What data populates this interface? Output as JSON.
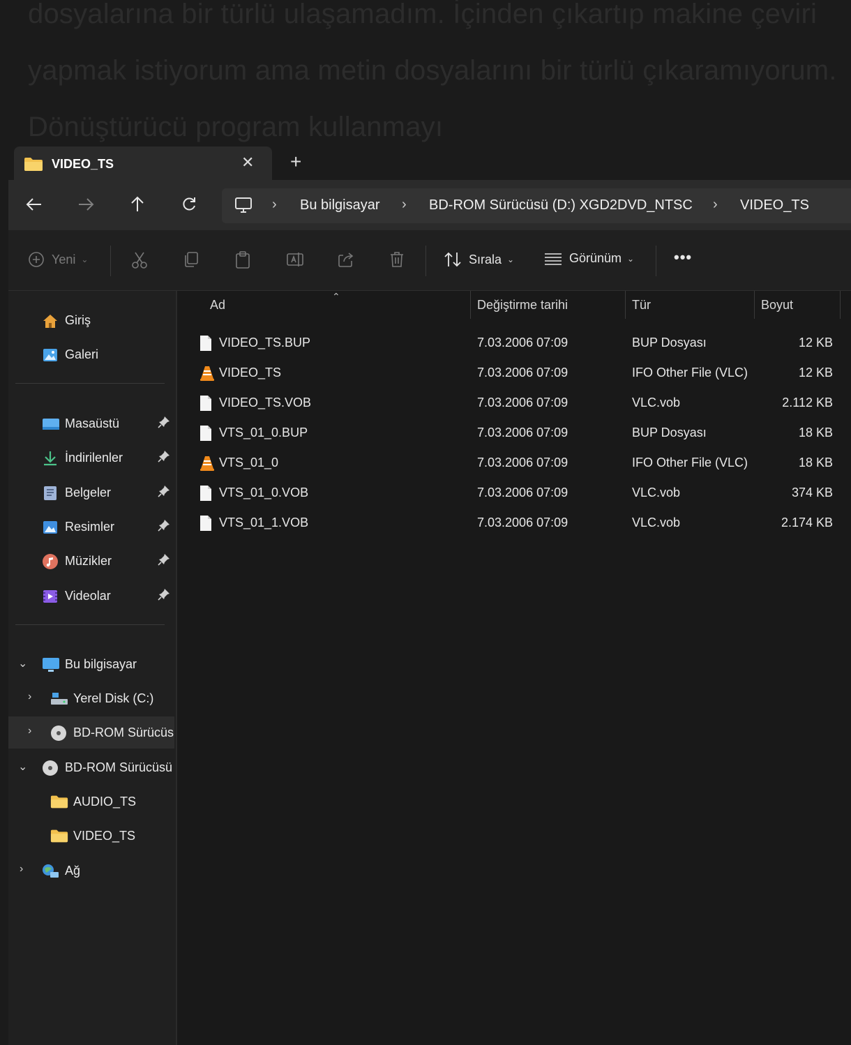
{
  "background_text": "dosyalarına bir türlü ulaşamadım. İçinden çıkartıp makine çeviri yapmak istiyorum ama metin dosyalarını bir türlü çıkaramıyorum. Dönüştürücü program kullanmayı",
  "tab": {
    "title": "VIDEO_TS"
  },
  "breadcrumb": [
    "Bu bilgisayar",
    "BD-ROM Sürücüsü (D:) XGD2DVD_NTSC",
    "VIDEO_TS"
  ],
  "commands": {
    "new": "Yeni",
    "sort": "Sırala",
    "view": "Görünüm"
  },
  "columns": {
    "name": "Ad",
    "date": "Değiştirme tarihi",
    "type": "Tür",
    "size": "Boyut"
  },
  "files": [
    {
      "name": "VIDEO_TS.BUP",
      "date": "7.03.2006 07:09",
      "type": "BUP Dosyası",
      "size": "12 KB",
      "icon": "file-icon"
    },
    {
      "name": "VIDEO_TS",
      "date": "7.03.2006 07:09",
      "type": "IFO Other File (VLC)",
      "size": "12 KB",
      "icon": "vlc-icon"
    },
    {
      "name": "VIDEO_TS.VOB",
      "date": "7.03.2006 07:09",
      "type": "VLC.vob",
      "size": "2.112 KB",
      "icon": "file-icon"
    },
    {
      "name": "VTS_01_0.BUP",
      "date": "7.03.2006 07:09",
      "type": "BUP Dosyası",
      "size": "18 KB",
      "icon": "file-icon"
    },
    {
      "name": "VTS_01_0",
      "date": "7.03.2006 07:09",
      "type": "IFO Other File (VLC)",
      "size": "18 KB",
      "icon": "vlc-icon"
    },
    {
      "name": "VTS_01_0.VOB",
      "date": "7.03.2006 07:09",
      "type": "VLC.vob",
      "size": "374 KB",
      "icon": "file-icon"
    },
    {
      "name": "VTS_01_1.VOB",
      "date": "7.03.2006 07:09",
      "type": "VLC.vob",
      "size": "2.174 KB",
      "icon": "file-icon"
    }
  ],
  "sidebar": {
    "top": [
      {
        "label": "Giriş",
        "icon": "home-icon"
      },
      {
        "label": "Galeri",
        "icon": "gallery-icon"
      }
    ],
    "pinned": [
      {
        "label": "Masaüstü",
        "icon": "desktop-icon"
      },
      {
        "label": "İndirilenler",
        "icon": "download-icon"
      },
      {
        "label": "Belgeler",
        "icon": "documents-icon"
      },
      {
        "label": "Resimler",
        "icon": "pictures-icon"
      },
      {
        "label": "Müzikler",
        "icon": "music-icon"
      },
      {
        "label": "Videolar",
        "icon": "videos-icon"
      }
    ],
    "tree": [
      {
        "label": "Bu bilgisayar",
        "icon": "computer-icon"
      },
      {
        "label": "Yerel Disk (C:)",
        "icon": "drive-icon"
      },
      {
        "label": "BD-ROM Sürücüs",
        "icon": "disc-icon"
      },
      {
        "label": "BD-ROM Sürücüsü",
        "icon": "disc-icon"
      },
      {
        "label": "AUDIO_TS",
        "icon": "folder-icon"
      },
      {
        "label": "VIDEO_TS",
        "icon": "folder-icon"
      },
      {
        "label": "Ağ",
        "icon": "network-icon"
      }
    ]
  }
}
